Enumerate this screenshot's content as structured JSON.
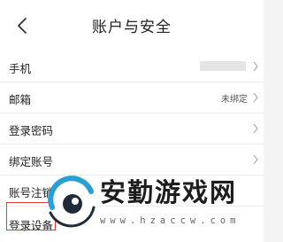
{
  "header": {
    "title": "账户与安全"
  },
  "rows": [
    {
      "label": "手机",
      "value": "",
      "masked": true
    },
    {
      "label": "邮箱",
      "value": "未绑定",
      "masked": false
    },
    {
      "label": "登录密码",
      "value": "",
      "masked": false
    },
    {
      "label": "绑定账号",
      "value": "",
      "masked": false
    },
    {
      "label": "账号注销",
      "value": "",
      "masked": false
    },
    {
      "label": "登录设备",
      "value": "",
      "masked": false
    }
  ],
  "watermark": {
    "text": "安勤游戏网",
    "url": "www.hzaccw.com"
  },
  "colors": {
    "highlight_border": "#e03a3a",
    "watermark_ring": "#2a9fd6"
  },
  "icons": {
    "back": "back-arrow-icon",
    "row_chevron": "chevron-right-icon"
  }
}
